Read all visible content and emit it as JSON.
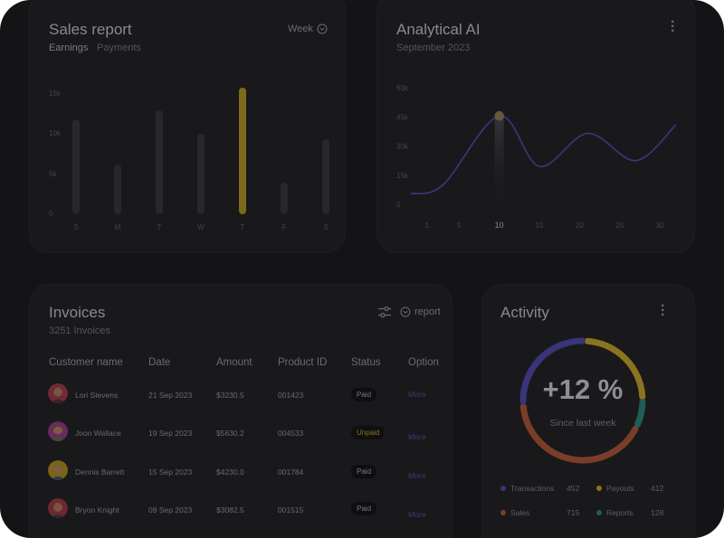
{
  "sales": {
    "title": "Sales report",
    "tabs": [
      "Earnings",
      "Payments"
    ],
    "period": "Week",
    "chart_data": {
      "type": "bar",
      "categories": [
        "S",
        "M",
        "T",
        "W",
        "T",
        "F",
        "S"
      ],
      "values": [
        11.8,
        6.2,
        13.0,
        10.0,
        15.8,
        4.0,
        9.4
      ],
      "yticks": [
        "15k",
        "10k",
        "5k",
        "0"
      ],
      "ylim": [
        0,
        16
      ],
      "highlight_index": 4
    }
  },
  "analytical": {
    "title": "Analytical AI",
    "subtitle": "September 2023",
    "chart_data": {
      "type": "line",
      "xticks": [
        "1",
        "5",
        "10",
        "15",
        "20",
        "25",
        "30"
      ],
      "yticks": [
        "60k",
        "45k",
        "30k",
        "15k",
        "0"
      ],
      "ylim": [
        0,
        60
      ],
      "xlim": [
        -1,
        32
      ],
      "points": [
        [
          -1,
          5.5
        ],
        [
          3,
          10
        ],
        [
          10,
          45.5
        ],
        [
          15,
          19.5
        ],
        [
          21,
          36.5
        ],
        [
          27,
          22.5
        ],
        [
          32,
          41
        ]
      ],
      "highlight_x": "10"
    }
  },
  "invoices": {
    "title": "Invoices",
    "count": "3251 Invoices",
    "report_label": "report",
    "columns": [
      "Customer name",
      "Date",
      "Amount",
      "Product ID",
      "Status",
      "Option"
    ],
    "rows": [
      {
        "name": "Lori Stevens",
        "date": "21 Sep 2023",
        "amount": "$3230.5",
        "pid": "001423",
        "status": "Paid",
        "option": "More"
      },
      {
        "name": "Joon Wallace",
        "date": "19 Sep 2023",
        "amount": "$5630.2",
        "pid": "004533",
        "status": "Unpaid",
        "option": "More"
      },
      {
        "name": "Dennis Barrett",
        "date": "15 Sep 2023",
        "amount": "$4230.0",
        "pid": "001784",
        "status": "Paid",
        "option": "More"
      },
      {
        "name": "Bryon Knight",
        "date": "09 Sep 2023",
        "amount": "$3082.5",
        "pid": "001515",
        "status": "Paid",
        "option": "More"
      }
    ]
  },
  "activity": {
    "title": "Activity",
    "percent": "+12 %",
    "caption": "Since last week",
    "chart_data": {
      "type": "pie",
      "slices": [
        {
          "label": "Transactions",
          "value": 452,
          "color": "#3a347a"
        },
        {
          "label": "Payouts",
          "value": 412,
          "color": "#8a741f"
        },
        {
          "label": "Sales",
          "value": 715,
          "color": "#7a3e28"
        },
        {
          "label": "Reports",
          "value": 128,
          "color": "#1d5e58"
        }
      ]
    },
    "legend": [
      {
        "label": "Transactions",
        "value": "452",
        "color": "#3a347a"
      },
      {
        "label": "Payouts",
        "value": "412",
        "color": "#8a741f"
      },
      {
        "label": "Sales",
        "value": "715",
        "color": "#7a3e28"
      },
      {
        "label": "Reports",
        "value": "128",
        "color": "#1d5e58"
      }
    ]
  },
  "colors": {
    "accent_gold": "#8a741f",
    "accent_purple": "#3d3a7a",
    "card_bg": "#19191b"
  }
}
